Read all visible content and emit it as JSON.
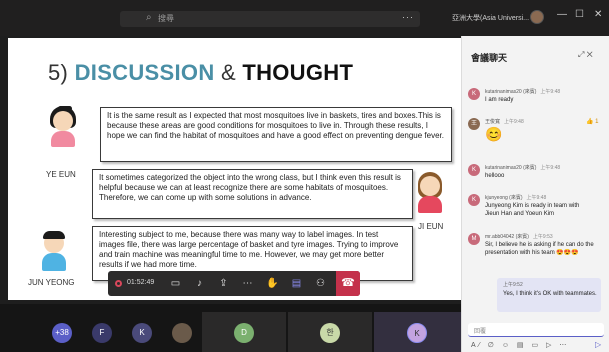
{
  "titlebar": {
    "search_placeholder": "搜尋",
    "more": "···",
    "org": "亞洲大學(Asia Universi...",
    "controls": {
      "minimize": "—",
      "maximize": "☐",
      "close": "✕"
    }
  },
  "slide": {
    "title_num": "5)",
    "title_word1": "DISCUSSION",
    "title_amp": "&",
    "title_word2": "THOUGHT",
    "bubble1": "It is the same result as I expected that most mosquitoes live in baskets, tires and boxes.This is because these areas are good conditions for mosquitoes to live in. Through these results, I hope we can find the habitat of mosquitoes and have a good effect on preventing dengue fever.",
    "bubble2": "It sometimes categorized the object into the wrong class, but I think even this result is helpful because we can at least recognize there are some habitats of mosquitoes. Therefore, we can come up with some solutions in advance.",
    "bubble3": "Interesting subject to me, because there was many way to label images. In test images file, there was large percentage of basket and tyre images. Trying to improve and train machine was meaningful time to me. However, we may get more better results if we had more time.",
    "person1": "YE EUN",
    "person2": "JI EUN",
    "person3": "JUN YEONG"
  },
  "meeting": {
    "timer": "01:52:49",
    "participants_extra": "+38",
    "avatars": [
      "F",
      "K",
      "D",
      "한",
      "K"
    ],
    "avatar_colors": [
      "#5b5fc7",
      "#3a3a6a",
      "#4a4a7a",
      "#7bb06f",
      "#c9d9a8",
      "#c3a3e0"
    ]
  },
  "chat": {
    "title": "會議聊天",
    "header_icons": "⤢ ✕",
    "messages": [
      {
        "initial": "K",
        "name": "kutarinanimas20 (來賓)",
        "time": "上午9:48",
        "text": "I am ready",
        "color": "#c86a7a"
      },
      {
        "initial": "王",
        "name": "王俊寬",
        "time": "上午9:48",
        "text": "😊",
        "color": "#8a6a52",
        "react": "👍 1"
      },
      {
        "initial": "K",
        "name": "kutarinanimas20 (來賓)",
        "time": "上午9:48",
        "text": "hellooo",
        "color": "#c86a7a"
      },
      {
        "initial": "K",
        "name": "kjunyeong (來賓)",
        "time": "上午9:48",
        "text": "Junyeong Kim is ready in team with Jieun Han and Yoeun Kim",
        "color": "#c86a7a"
      },
      {
        "initial": "M",
        "name": "mr.abb04042 (來賓)",
        "time": "上午9:53",
        "text": "Sir, I believe he is asking if he can do the presentation with his team 😍😍😍",
        "color": "#c86a7a"
      }
    ],
    "my_message": {
      "time": "上午9:52",
      "text": "Yes, I think it's OK with teammates."
    },
    "compose_placeholder": "回覆",
    "tools": "A⁄ ∅ ☺ ▤ ▭ ▷ ⋯",
    "send": "▷"
  }
}
